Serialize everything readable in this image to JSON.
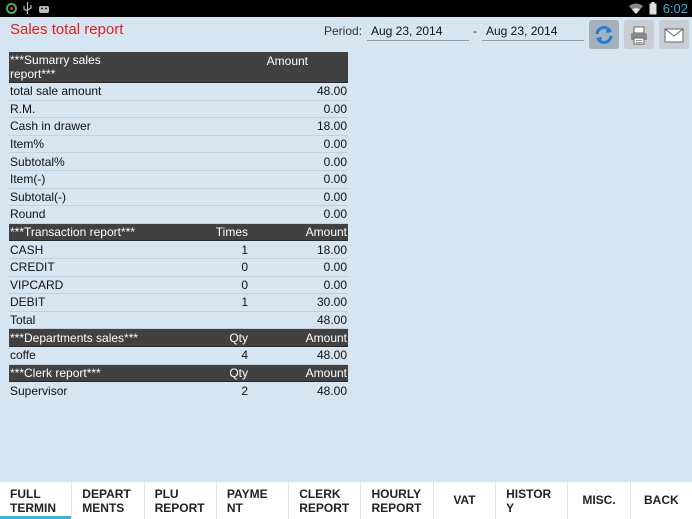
{
  "status_bar": {
    "time": "6:02",
    "colors": {
      "time": "#33b5e5"
    }
  },
  "header": {
    "title": "Sales total report",
    "period_label": "Period:",
    "date_from": "Aug 23, 2014",
    "separator": "-",
    "date_to": "Aug 23, 2014",
    "buttons": [
      {
        "name": "refresh-icon"
      },
      {
        "name": "print-icon"
      },
      {
        "name": "mail-icon"
      }
    ]
  },
  "summary": {
    "header_label": "***Sumarry sales report***",
    "header_amount": "Amount",
    "rows": [
      {
        "label": "total sale amount",
        "amount": "48.00"
      },
      {
        "label": "R.M.",
        "amount": "0.00"
      },
      {
        "label": "Cash in drawer",
        "amount": "18.00"
      },
      {
        "label": "Item%",
        "amount": "0.00"
      },
      {
        "label": "Subtotal%",
        "amount": "0.00"
      },
      {
        "label": "Item(-)",
        "amount": "0.00"
      },
      {
        "label": "Subtotal(-)",
        "amount": "0.00"
      },
      {
        "label": "Round",
        "amount": "0.00"
      }
    ]
  },
  "transactions": {
    "header_label": "***Transaction report***",
    "header_mid": "Times",
    "header_amount": "Amount",
    "rows": [
      {
        "label": "CASH",
        "mid": "1",
        "amount": "18.00"
      },
      {
        "label": "CREDIT",
        "mid": "0",
        "amount": "0.00"
      },
      {
        "label": "VIPCARD",
        "mid": "0",
        "amount": "0.00"
      },
      {
        "label": "DEBIT",
        "mid": "1",
        "amount": "30.00"
      },
      {
        "label": "Total",
        "mid": "",
        "amount": "48.00"
      }
    ]
  },
  "departments": {
    "header_label": "***Departments sales***",
    "header_mid": "Qty",
    "header_amount": "Amount",
    "rows": [
      {
        "label": "coffe",
        "mid": "4",
        "amount": "48.00"
      }
    ]
  },
  "clerks": {
    "header_label": "***Clerk report***",
    "header_mid": "Qty",
    "header_amount": "Amount",
    "rows": [
      {
        "label": "Supervisor",
        "mid": "2",
        "amount": "48.00"
      }
    ]
  },
  "tabs": [
    {
      "line1": "FULL",
      "line2": "TERMIN"
    },
    {
      "line1": "DEPART",
      "line2": "MENTS"
    },
    {
      "line1": "PLU",
      "line2": "REPORT"
    },
    {
      "line1": "PAYME",
      "line2": "NT"
    },
    {
      "line1": "CLERK",
      "line2": "REPORT"
    },
    {
      "line1": "HOURLY",
      "line2": "REPORT"
    },
    {
      "line1": "VAT",
      "line2": ""
    },
    {
      "line1": "HISTOR",
      "line2": "Y"
    },
    {
      "line1": "MISC.",
      "line2": ""
    },
    {
      "line1": "BACK",
      "line2": ""
    }
  ],
  "colors": {
    "background": "#d5e5f1",
    "title": "#e2201a",
    "header_row": "#414141",
    "accent": "#33b5e5"
  }
}
